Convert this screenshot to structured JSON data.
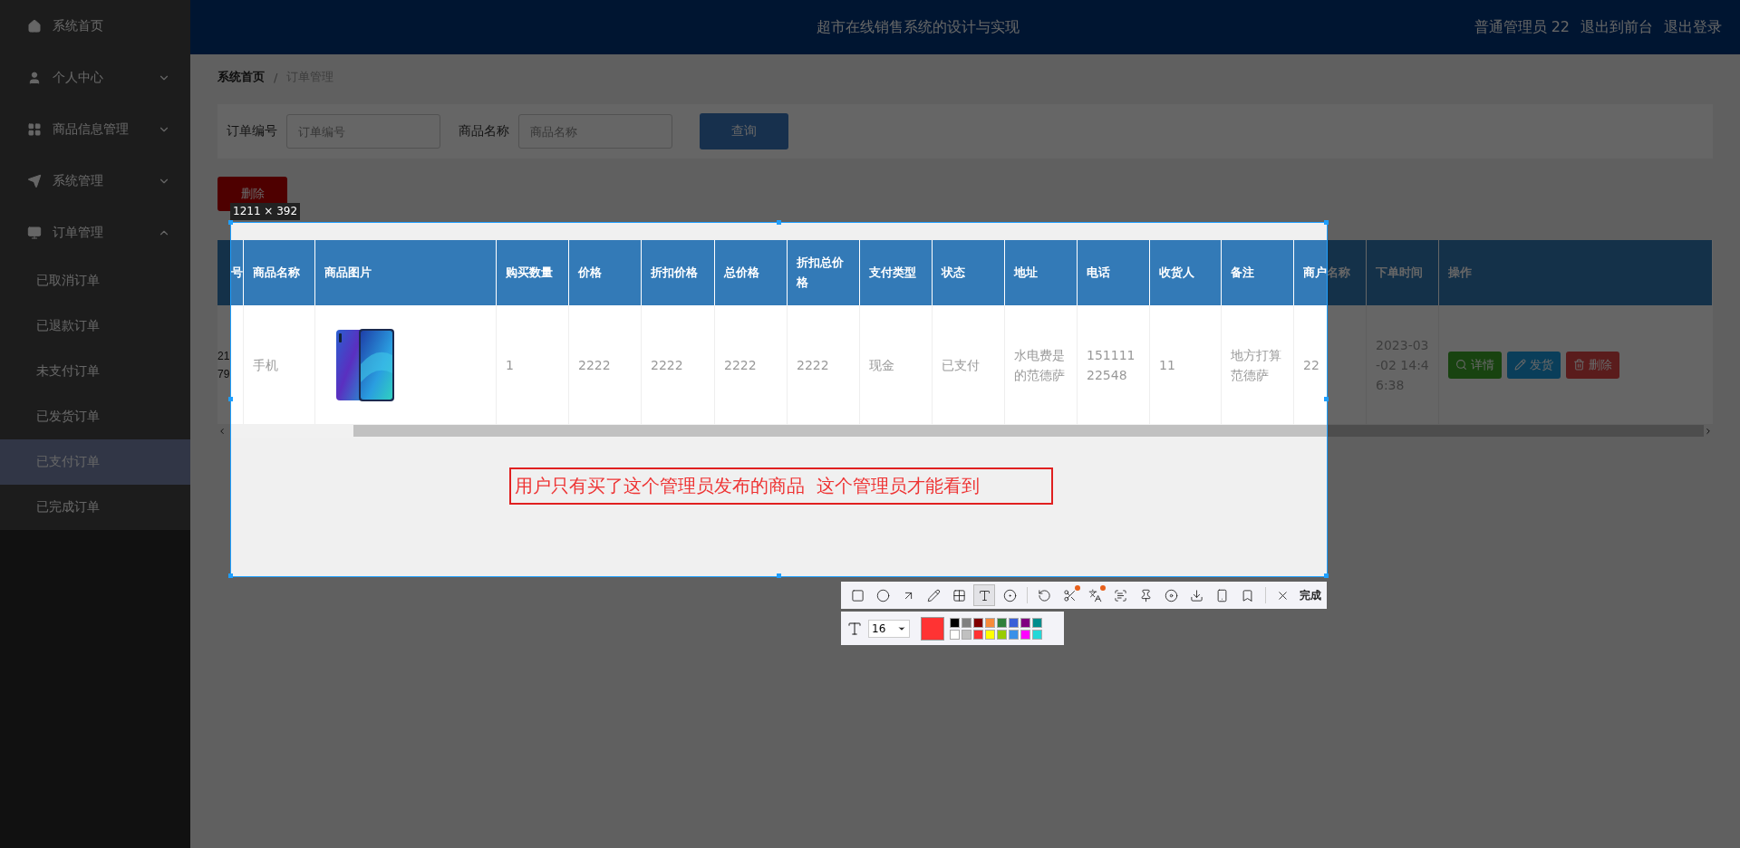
{
  "header": {
    "title": "超市在线销售系统的设计与实现",
    "user": "普通管理员 22",
    "links": [
      "退出到前台",
      "退出登录"
    ]
  },
  "sidebar": {
    "items": [
      {
        "label": "系统首页",
        "kind": "link"
      },
      {
        "label": "个人中心",
        "kind": "group",
        "expanded": false
      },
      {
        "label": "商品信息管理",
        "kind": "group",
        "expanded": false
      },
      {
        "label": "系统管理",
        "kind": "group",
        "expanded": false
      },
      {
        "label": "订单管理",
        "kind": "group",
        "expanded": true,
        "children": [
          {
            "label": "已取消订单",
            "selected": false
          },
          {
            "label": "已退款订单",
            "selected": false
          },
          {
            "label": "未支付订单",
            "selected": false
          },
          {
            "label": "已发货订单",
            "selected": false
          },
          {
            "label": "已支付订单",
            "selected": true
          },
          {
            "label": "已完成订单",
            "selected": false
          }
        ]
      }
    ]
  },
  "breadcrumb": [
    "系统首页",
    "订单管理"
  ],
  "breadcrumb_separator": "/",
  "search": {
    "fields": [
      {
        "label": "订单编号",
        "placeholder": "订单编号"
      },
      {
        "label": "商品名称",
        "placeholder": "商品名称"
      }
    ],
    "button": "查询"
  },
  "delete_button": "删除",
  "table": {
    "columns": [
      "号",
      "商品名称",
      "商品图片",
      "购买数量",
      "价格",
      "折扣价格",
      "总价格",
      "折扣总价格",
      "支付类型",
      "状态",
      "地址",
      "电话",
      "收货人",
      "备注",
      "商户名称",
      "下单时间",
      "操作"
    ],
    "rows": [
      {
        "cells": [
          {
            "kind": "text",
            "text": "2179"
          },
          {
            "kind": "text",
            "text": "手机"
          },
          {
            "kind": "picture"
          },
          {
            "kind": "text",
            "text": "1"
          },
          {
            "kind": "text",
            "text": "2222"
          },
          {
            "kind": "text",
            "text": "2222"
          },
          {
            "kind": "text",
            "text": "2222"
          },
          {
            "kind": "text",
            "text": "2222"
          },
          {
            "kind": "text",
            "text": "现金"
          },
          {
            "kind": "text",
            "text": "已支付"
          },
          {
            "kind": "text",
            "text": "水电费是的范德萨"
          },
          {
            "kind": "text",
            "text": "15111122548"
          },
          {
            "kind": "text",
            "text": "11"
          },
          {
            "kind": "text",
            "text": "地方打算范德萨"
          },
          {
            "kind": "text",
            "text": "22"
          },
          {
            "kind": "text",
            "text": "2023-03-02 14:46:38"
          },
          {
            "kind": "actions",
            "buttons": [
              {
                "kind": "detail",
                "label": "详情"
              },
              {
                "kind": "ship",
                "label": "发货"
              },
              {
                "kind": "delete",
                "label": "删除"
              }
            ]
          }
        ]
      }
    ]
  },
  "screenshot_tool": {
    "size_label": "1211 × 392",
    "annotation": "用户只有买了这个管理员发布的商品  这个管理员才能看到",
    "tools": [
      {
        "kind": "rect",
        "selected": false
      },
      {
        "kind": "circle",
        "selected": false
      },
      {
        "kind": "arrow",
        "selected": false
      },
      {
        "kind": "pencil",
        "selected": false
      },
      {
        "kind": "mosaic",
        "selected": false
      },
      {
        "kind": "text",
        "selected": true
      },
      {
        "kind": "number",
        "selected": false
      },
      {
        "kind": "divider"
      },
      {
        "kind": "undo",
        "selected": false
      },
      {
        "kind": "cut",
        "selected": false,
        "dot": true
      },
      {
        "kind": "translate",
        "selected": false,
        "dot": true
      },
      {
        "kind": "ocr",
        "selected": false
      },
      {
        "kind": "pin",
        "selected": false
      },
      {
        "kind": "record",
        "selected": false
      },
      {
        "kind": "download",
        "selected": false
      },
      {
        "kind": "phone",
        "selected": false
      },
      {
        "kind": "bookmark",
        "selected": false
      },
      {
        "kind": "divider"
      },
      {
        "kind": "close",
        "selected": false
      },
      {
        "kind": "done",
        "label": "完成",
        "selected": false
      }
    ],
    "font_size": "16",
    "current_color": {
      "color": "#ff3333"
    },
    "palette": [
      {
        "color": "#000000"
      },
      {
        "color": "#808080"
      },
      {
        "color": "#800000"
      },
      {
        "color": "#f78a3a"
      },
      {
        "color": "#30803a"
      },
      {
        "color": "#3a5fd8"
      },
      {
        "color": "#800080"
      },
      {
        "color": "#008c8c"
      },
      {
        "color": "#ffffff"
      },
      {
        "color": "#c0c0c0"
      },
      {
        "color": "#ff3333"
      },
      {
        "color": "#ffff00"
      },
      {
        "color": "#99cc00"
      },
      {
        "color": "#3a90e8"
      },
      {
        "color": "#ff00ff"
      },
      {
        "color": "#22d8d8"
      }
    ]
  }
}
